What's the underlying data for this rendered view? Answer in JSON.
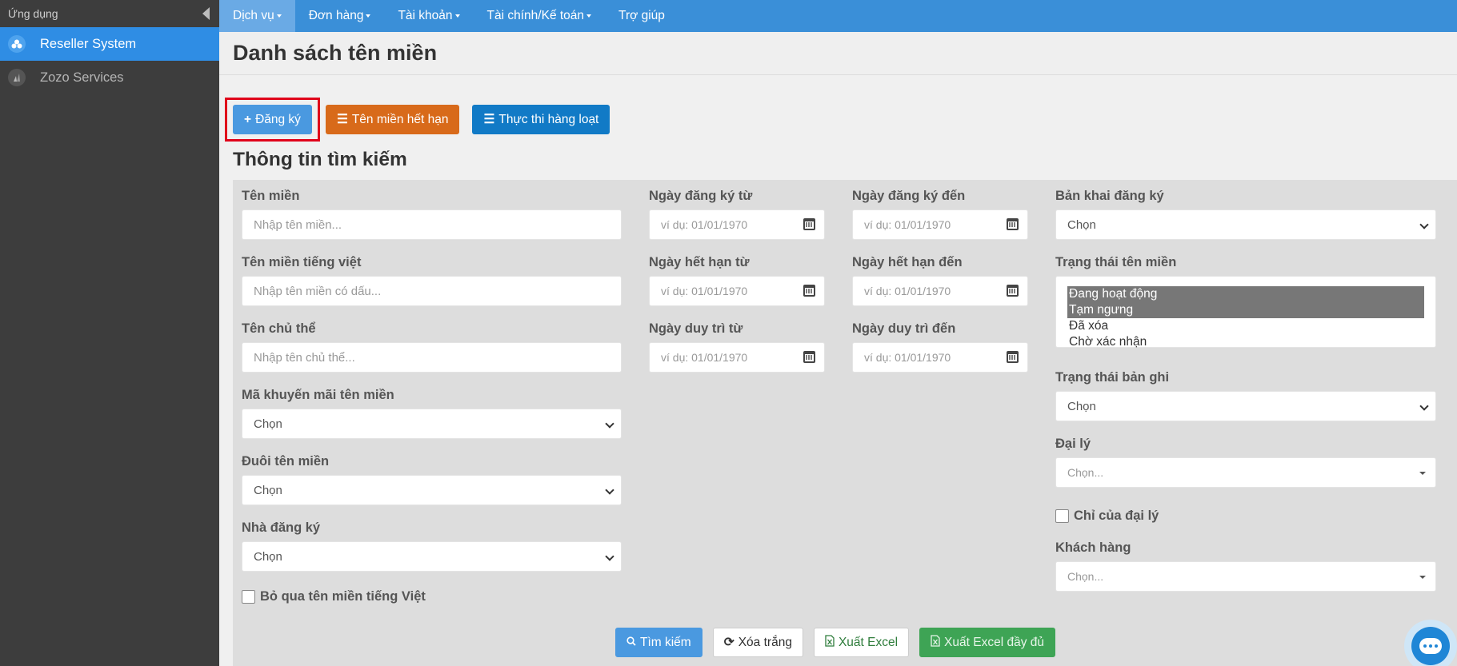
{
  "sidebar": {
    "header": "Ứng dụng",
    "items": [
      {
        "label": "Reseller System",
        "active": true
      },
      {
        "label": "Zozo Services",
        "active": false
      }
    ]
  },
  "topnav": {
    "items": [
      {
        "label": "Dịch vụ",
        "active": true,
        "dropdown": true
      },
      {
        "label": "Đơn hàng",
        "active": false,
        "dropdown": true
      },
      {
        "label": "Tài khoản",
        "active": false,
        "dropdown": true
      },
      {
        "label": "Tài chính/Kế toán",
        "active": false,
        "dropdown": true
      },
      {
        "label": "Trợ giúp",
        "active": false,
        "dropdown": false
      }
    ]
  },
  "page": {
    "title": "Danh sách tên miền",
    "actions": {
      "register": "Đăng ký",
      "expired": "Tên miền hết hạn",
      "batch": "Thực thi hàng loạt"
    },
    "search_title": "Thông tin tìm kiếm"
  },
  "form": {
    "domain": {
      "label": "Tên miền",
      "placeholder": "Nhập tên miền..."
    },
    "domain_vn": {
      "label": "Tên miền tiếng việt",
      "placeholder": "Nhập tên miền có dấu..."
    },
    "owner": {
      "label": "Tên chủ thể",
      "placeholder": "Nhập tên chủ thể..."
    },
    "promo": {
      "label": "Mã khuyến mãi tên miền",
      "value": "Chọn"
    },
    "extension": {
      "label": "Đuôi tên miền",
      "value": "Chọn"
    },
    "registrar": {
      "label": "Nhà đăng ký",
      "value": "Chọn"
    },
    "skip_vn": {
      "label": "Bỏ qua tên miền tiếng Việt"
    },
    "reg_from": {
      "label": "Ngày đăng ký từ",
      "placeholder": "ví dụ: 01/01/1970"
    },
    "reg_to": {
      "label": "Ngày đăng ký đến",
      "placeholder": "ví dụ: 01/01/1970"
    },
    "exp_from": {
      "label": "Ngày hết hạn từ",
      "placeholder": "ví dụ: 01/01/1970"
    },
    "exp_to": {
      "label": "Ngày hết hạn đến",
      "placeholder": "ví dụ: 01/01/1970"
    },
    "renew_from": {
      "label": "Ngày duy trì từ",
      "placeholder": "ví dụ: 01/01/1970"
    },
    "renew_to": {
      "label": "Ngày duy trì đến",
      "placeholder": "ví dụ: 01/01/1970"
    },
    "declaration": {
      "label": "Bản khai đăng ký",
      "value": "Chọn"
    },
    "domain_status": {
      "label": "Trạng thái tên miền",
      "options": [
        {
          "label": "Đang hoạt động",
          "selected": true
        },
        {
          "label": "Tạm ngưng",
          "selected": true
        },
        {
          "label": "Đã xóa",
          "selected": false
        },
        {
          "label": "Chờ xác nhận",
          "selected": false
        }
      ]
    },
    "record_status": {
      "label": "Trạng thái bản ghi",
      "value": "Chọn"
    },
    "agent": {
      "label": "Đại lý",
      "value": "Chọn..."
    },
    "agent_only": {
      "label": "Chỉ của đại lý"
    },
    "customer": {
      "label": "Khách hàng",
      "value": "Chọn..."
    }
  },
  "bottom_actions": {
    "search": "Tìm kiếm",
    "clear": "Xóa trắng",
    "export": "Xuất Excel",
    "export_full": "Xuất Excel đầy đủ"
  }
}
